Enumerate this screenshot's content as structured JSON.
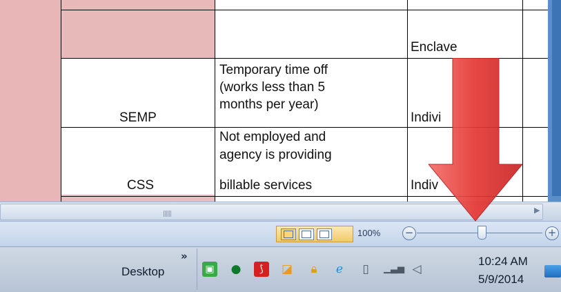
{
  "sheet": {
    "rows": [
      {
        "col_b": "",
        "col_c": "",
        "col_d": "Enclave"
      },
      {
        "col_b": "SEMP",
        "col_c_lines": [
          "Temporary time off",
          "(works less than 5",
          "months per year)"
        ],
        "col_d": "Indivi"
      },
      {
        "col_b": "CSS",
        "col_c_lines": [
          "Not employed and",
          "agency is providing",
          "billable services"
        ],
        "col_d": "Indiv"
      }
    ]
  },
  "statusbar": {
    "zoom_label": "100%",
    "zoom_percent": 100,
    "zoom_minus": "−",
    "zoom_plus": "+",
    "views": [
      "normal-view-icon",
      "page-layout-icon",
      "page-break-preview-icon"
    ]
  },
  "taskbar": {
    "toolbar_label": "Desktop",
    "overflow_chevron": "»",
    "tray_icons": [
      "green-app-icon",
      "chat-bubble-icon",
      "acrobat-icon",
      "paint-icon",
      "lock-icon",
      "ie-icon",
      "device-icon",
      "signal-bars-icon",
      "speaker-icon"
    ],
    "time": "10:24 AM",
    "date": "5/9/2014"
  },
  "colors": {
    "pink_cells": "#e8b6b6",
    "overlay_arrow": "#e53935",
    "taskbar": "#c3cfde"
  }
}
